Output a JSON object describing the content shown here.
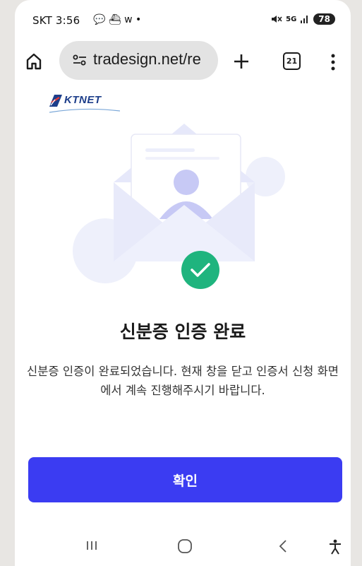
{
  "status_bar": {
    "time": "SKT 3:56",
    "notif_icons": "💬 ⛴ w •",
    "network": "5G",
    "battery": "78"
  },
  "browser": {
    "url": "tradesign.net/re",
    "tab_count": "21"
  },
  "brand": {
    "logo_text": "KTNET",
    "accent": "#3b3cf2",
    "success": "#1fb47e"
  },
  "content": {
    "title": "신분증 인증 완료",
    "description": "신분증 인증이 완료되었습니다. 현재 창을 닫고 인증서 신청 화면에서 계속 진행해주시기 바랍니다.",
    "confirm_label": "확인"
  },
  "nav_bar": {
    "items": [
      "recent-apps",
      "home",
      "back",
      "accessibility"
    ]
  }
}
